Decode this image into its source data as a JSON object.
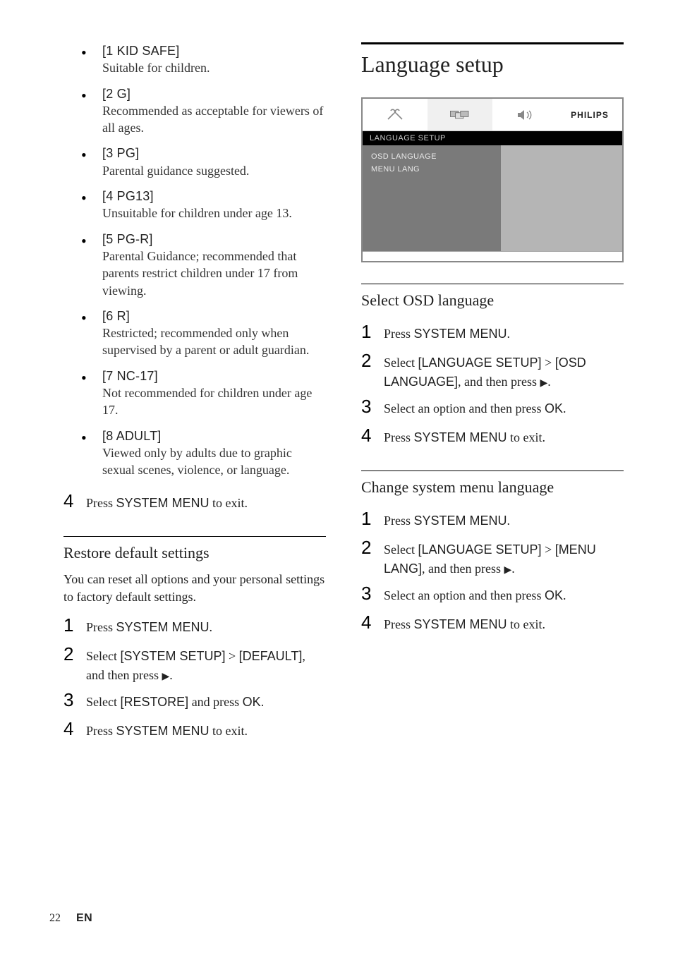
{
  "ratings": [
    {
      "label": "[1 KID SAFE]",
      "desc": "Suitable for children."
    },
    {
      "label": "[2 G]",
      "desc": "Recommended as acceptable for viewers of all ages."
    },
    {
      "label": "[3 PG]",
      "desc": "Parental guidance suggested."
    },
    {
      "label": "[4 PG13]",
      "desc": "Unsuitable for children under age 13."
    },
    {
      "label": "[5 PG-R]",
      "desc": "Parental Guidance; recommended that parents restrict children under 17 from viewing."
    },
    {
      "label": "[6 R]",
      "desc": "Restricted; recommended only when supervised by a parent or adult guardian."
    },
    {
      "label": "[7 NC-17]",
      "desc": "Not recommended for children under age 17."
    },
    {
      "label": "[8 ADULT]",
      "desc": "Viewed only by adults due to graphic sexual scenes, violence, or language."
    }
  ],
  "left_step4": {
    "num": "4",
    "pre": "Press ",
    "sm": "SYSTEM MENU",
    "post": " to exit."
  },
  "restore": {
    "heading": "Restore default settings",
    "intro": "You can reset all options and your personal settings to factory default settings.",
    "steps": {
      "s1": {
        "num": "1",
        "pre": "Press ",
        "sm": "SYSTEM MENU",
        "post": "."
      },
      "s2": {
        "num": "2",
        "pre": "Select ",
        "b1": "[SYSTEM SETUP]",
        "mid": " > ",
        "b2": "[DEFAULT]",
        "post": ", and then press ",
        "arrow": "▶",
        "end": "."
      },
      "s3": {
        "num": "3",
        "pre": "Select ",
        "b1": "[RESTORE]",
        "mid": " and press ",
        "b2": "OK",
        "post": "."
      },
      "s4": {
        "num": "4",
        "pre": "Press ",
        "sm": "SYSTEM MENU",
        "post": " to exit."
      }
    }
  },
  "right": {
    "h1": "Language setup",
    "osd": {
      "brand": "PHILIPS",
      "title": "LANGUAGE SETUP",
      "items": [
        "OSD LANGUAGE",
        "MENU LANG"
      ]
    },
    "sec1": {
      "heading": "Select OSD language",
      "s1": {
        "num": "1",
        "pre": "Press ",
        "sm": "SYSTEM MENU",
        "post": "."
      },
      "s2": {
        "num": "2",
        "pre": "Select ",
        "b1": "[LANGUAGE SETUP]",
        "mid": " > ",
        "b2": "[OSD LANGUAGE]",
        "post": ", and then press ",
        "arrow": "▶",
        "end": "."
      },
      "s3": {
        "num": "3",
        "pre": "Select an option and then press ",
        "b1": "OK",
        "post": "."
      },
      "s4": {
        "num": "4",
        "pre": "Press ",
        "sm": "SYSTEM MENU",
        "post": " to exit."
      }
    },
    "sec2": {
      "heading": "Change system menu language",
      "s1": {
        "num": "1",
        "pre": "Press ",
        "sm": "SYSTEM MENU",
        "post": "."
      },
      "s2": {
        "num": "2",
        "pre": "Select ",
        "b1": "[LANGUAGE SETUP]",
        "mid": " > ",
        "b2": "[MENU LANG]",
        "post": ", and then press ",
        "arrow": "▶",
        "end": "."
      },
      "s3": {
        "num": "3",
        "pre": "Select an option and then press ",
        "b1": "OK",
        "post": "."
      },
      "s4": {
        "num": "4",
        "pre": "Press ",
        "sm": "SYSTEM MENU",
        "post": " to exit."
      }
    }
  },
  "footer": {
    "page": "22",
    "lang": "EN"
  }
}
